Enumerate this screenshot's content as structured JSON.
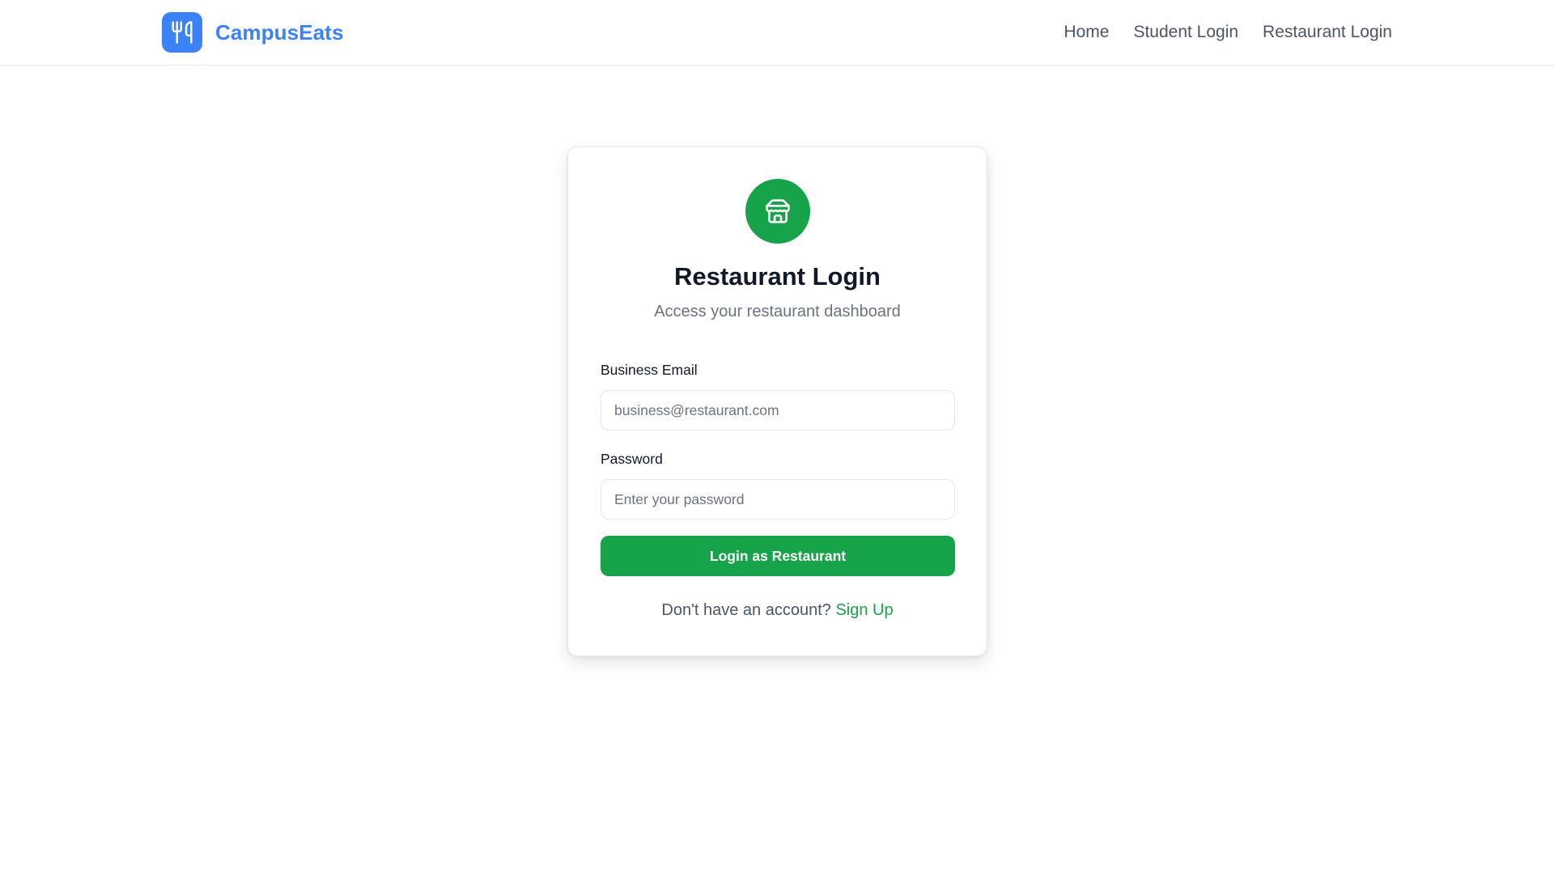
{
  "header": {
    "brand_name": "CampusEats",
    "brand_icon": "utensils-icon",
    "nav": [
      {
        "label": "Home"
      },
      {
        "label": "Student Login"
      },
      {
        "label": "Restaurant Login"
      }
    ]
  },
  "card": {
    "icon": "store-icon",
    "title": "Restaurant Login",
    "subtitle": "Access your restaurant dashboard",
    "email": {
      "label": "Business Email",
      "placeholder": "business@restaurant.com",
      "value": ""
    },
    "password": {
      "label": "Password",
      "placeholder": "Enter your password",
      "value": ""
    },
    "submit_label": "Login as Restaurant",
    "signup_prompt": "Don't have an account?",
    "signup_link": "Sign Up"
  },
  "colors": {
    "brand_blue": "#3b82f6",
    "accent_green": "#16a34a",
    "muted_text": "#6b7280",
    "border": "#e5e7eb"
  }
}
